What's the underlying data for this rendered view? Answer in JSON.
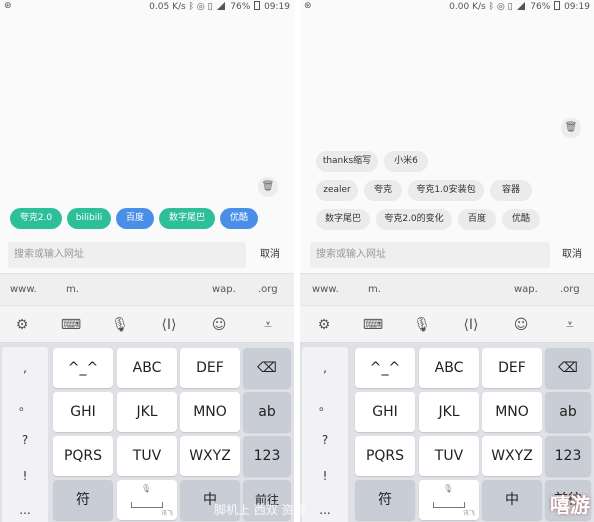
{
  "left": {
    "status": {
      "speed": "0.05 K/s",
      "battery": "76%",
      "time": "09:19"
    },
    "chips": [
      {
        "label": "夸克2.0",
        "color": "green"
      },
      {
        "label": "bilibili",
        "color": "green"
      },
      {
        "label": "百度",
        "color": "blue"
      },
      {
        "label": "数字尾巴",
        "color": "green"
      },
      {
        "label": "优酷",
        "color": "blue"
      }
    ],
    "search_placeholder": "搜索或输入网址",
    "cancel": "取消"
  },
  "right": {
    "status": {
      "speed": "0.00 K/s",
      "battery": "76%",
      "time": "09:19"
    },
    "chips": [
      [
        "thanks缩写",
        "小米6"
      ],
      [
        "zealer",
        "夸克",
        "夸克1.0安装包",
        "容器"
      ],
      [
        "数字尾巴",
        "夸克2.0的变化",
        "百度",
        "优酷"
      ]
    ],
    "search_placeholder": "搜索或输入网址",
    "cancel": "取消"
  },
  "url_shortcuts": [
    "www.",
    "m.",
    "wap.",
    ".org"
  ],
  "toolbar_icons": [
    "gear-icon",
    "keyboard-icon",
    "mic-icon",
    "cursor-move-icon",
    "emoji-icon",
    "hide-keyboard-icon"
  ],
  "symbols": [
    ",",
    "。",
    "?",
    "!",
    "..."
  ],
  "keys": {
    "row1": [
      "^_^",
      "ABC",
      "DEF"
    ],
    "row2": [
      "GHI",
      "JKL",
      "MNO",
      "ab"
    ],
    "row3": [
      "PQRS",
      "TUV",
      "WXYZ",
      "123"
    ],
    "row4": [
      "符",
      "中",
      "前往"
    ],
    "space_sub": "讯飞"
  },
  "watermark": "脚机上 西双 资源",
  "brand": "嘻游"
}
